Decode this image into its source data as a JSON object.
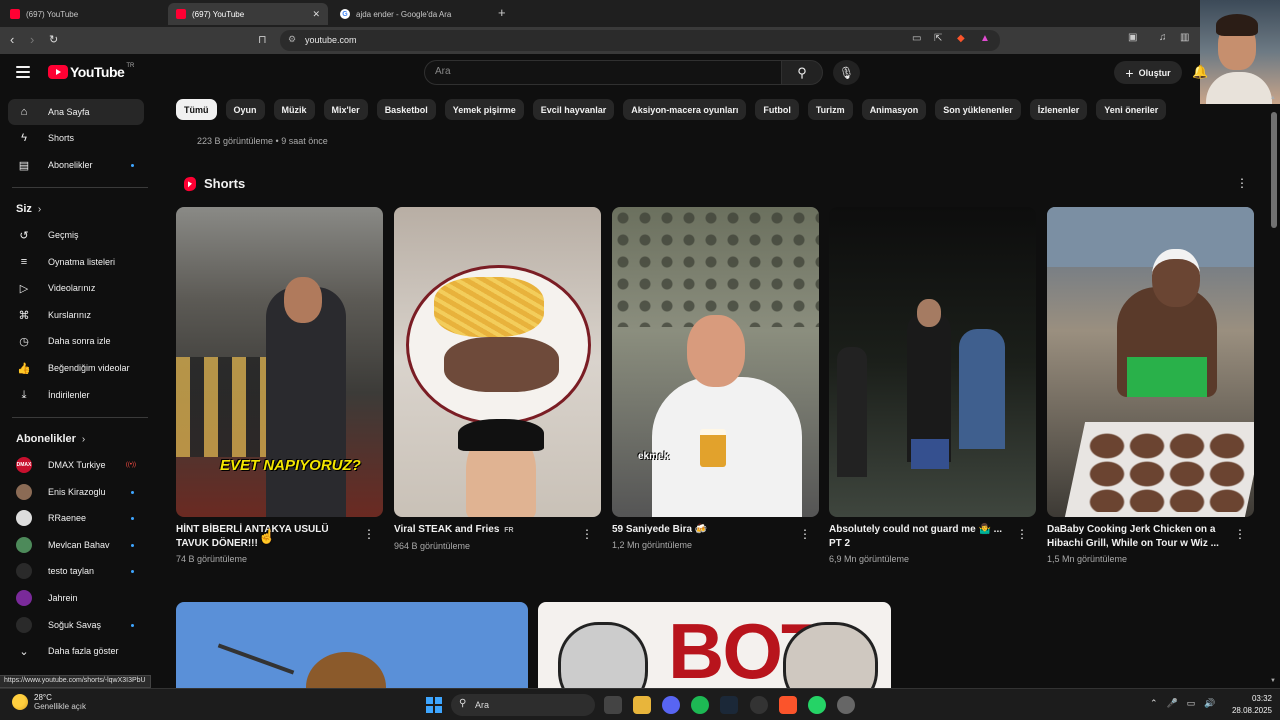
{
  "browser": {
    "tabs": [
      {
        "title": "(697) YouTube",
        "favicon": "youtube-favicon",
        "active": false
      },
      {
        "title": "(697) YouTube",
        "favicon": "youtube-favicon",
        "active": true
      },
      {
        "title": "ajda ender - Google'da Ara",
        "favicon": "google-favicon",
        "active": false
      }
    ],
    "new_tab_label": "+",
    "url": "youtube.com"
  },
  "header": {
    "logo_text": "YouTube",
    "logo_country": "TR",
    "search_placeholder": "Ara",
    "create_label": "Oluştur"
  },
  "sidebar": {
    "main": [
      {
        "label": "Ana Sayfa",
        "icon": "home-icon",
        "active": true
      },
      {
        "label": "Shorts",
        "icon": "shorts-icon"
      },
      {
        "label": "Abonelikler",
        "icon": "subscriptions-icon",
        "dot": true
      }
    ],
    "you_heading": "Siz",
    "you": [
      {
        "label": "Geçmiş",
        "icon": "history-icon"
      },
      {
        "label": "Oynatma listeleri",
        "icon": "playlists-icon"
      },
      {
        "label": "Videolarınız",
        "icon": "your-videos-icon"
      },
      {
        "label": "Kurslarınız",
        "icon": "courses-icon"
      },
      {
        "label": "Daha sonra izle",
        "icon": "watch-later-icon"
      },
      {
        "label": "Beğendiğim videolar",
        "icon": "liked-videos-icon"
      },
      {
        "label": "İndirilenler",
        "icon": "downloads-icon"
      }
    ],
    "subs_heading": "Abonelikler",
    "subs": [
      {
        "label": "DMAX Turkiye",
        "avatar_text": "DMAX",
        "avatar_bg": "#c8102e",
        "live": "((•))"
      },
      {
        "label": "Enis Kirazoglu",
        "avatar_text": "",
        "avatar_bg": "#8b6b55",
        "dot": true
      },
      {
        "label": "RRaenee",
        "avatar_text": "",
        "avatar_bg": "#ddd",
        "dot": true
      },
      {
        "label": "Mevlcan Bahav",
        "avatar_text": "",
        "avatar_bg": "#4d8a5a",
        "dot": true
      },
      {
        "label": "testo taylan",
        "avatar_text": "",
        "avatar_bg": "#2a2a2a",
        "dot": true
      },
      {
        "label": "Jahrein",
        "avatar_text": "",
        "avatar_bg": "#7a2a9a"
      },
      {
        "label": "Soğuk Savaş",
        "avatar_text": "",
        "avatar_bg": "#2a2a2a",
        "dot": true
      }
    ],
    "show_more": "Daha fazla göster"
  },
  "chips": [
    "Tümü",
    "Oyun",
    "Müzik",
    "Mix'ler",
    "Basketbol",
    "Yemek pişirme",
    "Evcil hayvanlar",
    "Aksiyon-macera oyunları",
    "Futbol",
    "Turizm",
    "Animasyon",
    "Son yüklenenler",
    "İzlenenler",
    "Yeni öneriler"
  ],
  "previous_row": {
    "meta": "223 B görüntüleme • 9 saat önce"
  },
  "shorts": {
    "title": "Shorts",
    "items": [
      {
        "title": "HİNT BİBERLİ ANTAKYA USULÜ TAVUK DÖNER!!!",
        "views": "74 B görüntüleme",
        "overlay": "EVET NAPIYORUZ?"
      },
      {
        "title": "Viral STEAK and Fries",
        "badge": "FR",
        "views": "964 B görüntüleme"
      },
      {
        "title": "59 Saniyede Bira 🍻",
        "views": "1,2 Mn görüntüleme",
        "overlay": "ekmek"
      },
      {
        "title": "Absolutely could not guard me 🤷‍♂️ ... PT 2",
        "views": "6,9 Mn görüntüleme"
      },
      {
        "title": "DaBaby Cooking Jerk Chicken on a Hibachi Grill, While on Tour w Wiz ...",
        "views": "1,5 Mn görüntüleme"
      }
    ]
  },
  "status_url": "https://www.youtube.com/shorts/-lqwX3I3PbU",
  "taskbar": {
    "weather_temp": "28°C",
    "weather_desc": "Genellikle açık",
    "search_text": "Ara",
    "time": "03:32",
    "date": "28.08.2025"
  }
}
